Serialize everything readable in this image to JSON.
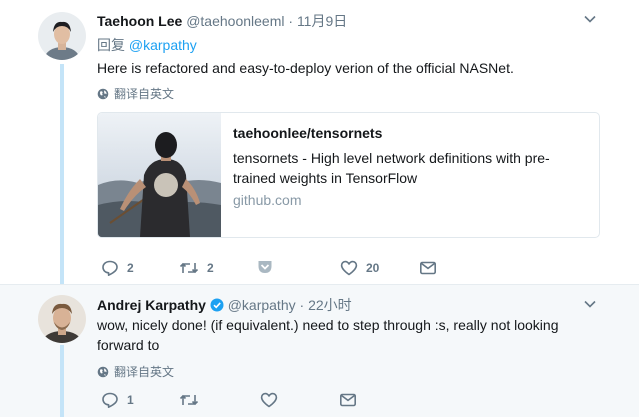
{
  "tweet1": {
    "name": "Taehoon Lee",
    "handle": "@taehoonleeml",
    "sep": "·",
    "time": "11月9日",
    "reply_label": "回复",
    "reply_handle": "@karpathy",
    "text": "Here is refactored and easy-to-deploy verion of the official NASNet.",
    "translate": "翻译自英文",
    "card": {
      "title": "taehoonlee/tensornets",
      "description": "tensornets - High level network definitions with pre-trained weights in TensorFlow",
      "domain": "github.com"
    },
    "actions": {
      "replies": "2",
      "retweets": "2",
      "likes": "20"
    }
  },
  "tweet2": {
    "name": "Andrej Karpathy",
    "handle": "@karpathy",
    "sep": "·",
    "time": "22小时",
    "text": "wow, nicely done! (if equivalent.) need to step through :s, really not looking forward to",
    "translate": "翻译自英文",
    "actions": {
      "replies": "1"
    }
  },
  "colors": {
    "accent": "#1da1f2",
    "muted": "#657786",
    "thread": "#c4e4f8",
    "verified": "#1da1f2"
  },
  "icons": [
    "globe-icon",
    "reply-icon",
    "retweet-icon",
    "like-icon",
    "message-icon",
    "caret-down-icon",
    "verified-icon",
    "pocket-icon"
  ]
}
